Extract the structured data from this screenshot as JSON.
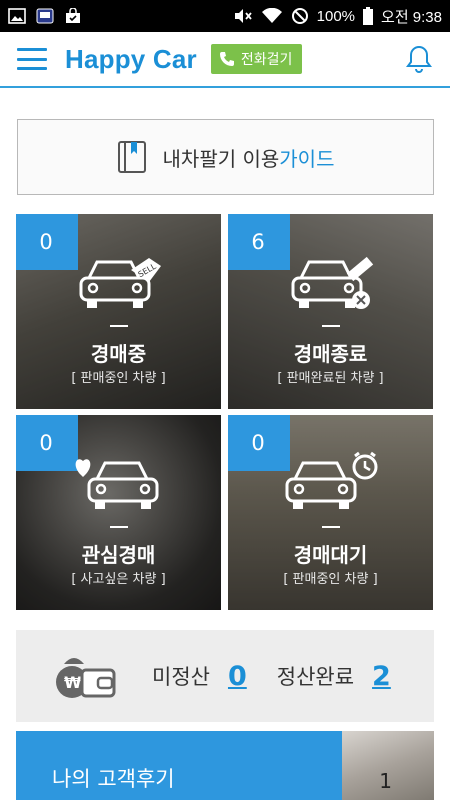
{
  "status_bar": {
    "battery": "100%",
    "time": "오전 9:38"
  },
  "header": {
    "brand": "Happy Car",
    "call_label": "전화걸기"
  },
  "guide": {
    "prefix": "내차팔기 이용",
    "highlight": "가이드"
  },
  "tiles": [
    {
      "count": "0",
      "title": "경매중",
      "subtitle": "[ 판매중인 차량 ]",
      "icon": "car-sell-icon"
    },
    {
      "count": "6",
      "title": "경매종료",
      "subtitle": "[ 판매완료된 차량 ]",
      "icon": "car-gavel-icon"
    },
    {
      "count": "0",
      "title": "관심경매",
      "subtitle": "[ 사고싶은 차량 ]",
      "icon": "car-heart-icon"
    },
    {
      "count": "0",
      "title": "경매대기",
      "subtitle": "[ 판매중인 차량 ]",
      "icon": "car-alarm-icon"
    }
  ],
  "settlement": {
    "unsettled_label": "미정산",
    "unsettled_value": "0",
    "settled_label": "정산완료",
    "settled_value": "2"
  },
  "review": {
    "title": "나의 고객후기",
    "count": "1"
  },
  "colors": {
    "accent": "#1b8fd6",
    "tile_badge": "#2e97de",
    "call_button": "#7cc14a"
  }
}
